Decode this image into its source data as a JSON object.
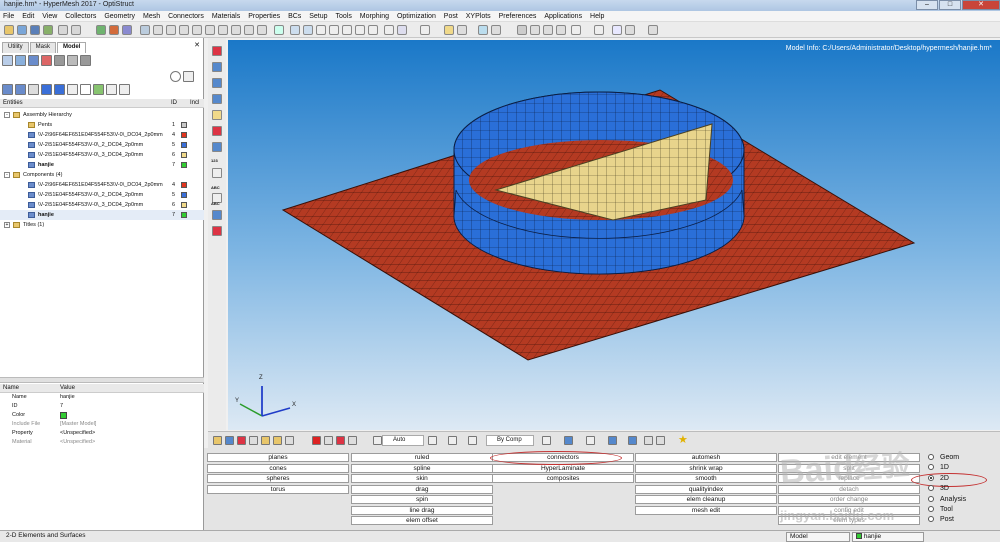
{
  "window": {
    "title": "hanjie.hm* - HyperMesh 2017 - OptiStruct"
  },
  "menu": [
    "File",
    "Edit",
    "View",
    "Collectors",
    "Geometry",
    "Mesh",
    "Connectors",
    "Materials",
    "Properties",
    "BCs",
    "Setup",
    "Tools",
    "Morphing",
    "Optimization",
    "Post",
    "XYPlots",
    "Preferences",
    "Applications",
    "Help"
  ],
  "left_panel": {
    "tabs": [
      "Utility",
      "Mask",
      "Model"
    ],
    "active_tab": "Model",
    "entities_header": {
      "entities": "Entities",
      "id": "ID",
      "incl": "Incl"
    },
    "tree": [
      {
        "label": "Assembly Hierarchy",
        "indent": 0,
        "kind": "folder",
        "expander": "-"
      },
      {
        "label": "Pents",
        "indent": 2,
        "kind": "folder",
        "id": "1",
        "color": "#c8c8c8"
      },
      {
        "label": "\\V-2\\96F64EF651E04F554F53\\V-0\\_DC04_2p0mm",
        "indent": 2,
        "kind": "comp",
        "id": "4",
        "color": "#e0351e"
      },
      {
        "label": "\\V-2\\51E04F554F53\\V-0\\_2_DC04_2p0mm",
        "indent": 2,
        "kind": "comp",
        "id": "5",
        "color": "#3a6fd8"
      },
      {
        "label": "\\V-2\\51E04F554F53\\V-0\\_3_DC04_2p0mm",
        "indent": 2,
        "kind": "comp",
        "id": "6",
        "color": "#f0d98a"
      },
      {
        "label": "hanjie",
        "indent": 2,
        "kind": "comp",
        "id": "7",
        "color": "#33cc33",
        "bold": true
      },
      {
        "label": "Components (4)",
        "indent": 0,
        "kind": "folder",
        "expander": "-"
      },
      {
        "label": "\\V-2\\96F64EF651E04F554F53\\V-0\\_DC04_2p0mm",
        "indent": 2,
        "kind": "comp",
        "id": "4",
        "color": "#e0351e"
      },
      {
        "label": "\\V-2\\51E04F554F53\\V-0\\_2_DC04_2p0mm",
        "indent": 2,
        "kind": "comp",
        "id": "5",
        "color": "#3a6fd8"
      },
      {
        "label": "\\V-2\\51E04F554F53\\V-0\\_3_DC04_2p0mm",
        "indent": 2,
        "kind": "comp",
        "id": "6",
        "color": "#f0d98a"
      },
      {
        "label": "hanjie",
        "indent": 2,
        "kind": "comp",
        "id": "7",
        "color": "#33cc33",
        "bold": true,
        "selected": true
      },
      {
        "label": "Titles (1)",
        "indent": 0,
        "kind": "folder",
        "expander": "+"
      }
    ],
    "properties": {
      "header": {
        "name": "Name",
        "value": "Value"
      },
      "rows": [
        {
          "key": "Name",
          "value": "hanjie"
        },
        {
          "key": "ID",
          "value": "7"
        },
        {
          "key": "Color",
          "value": "",
          "swatch": "#33cc33"
        },
        {
          "key": "Include File",
          "value": "[Master Model]",
          "grey": true
        },
        {
          "key": "Property",
          "value": "<Unspecified>"
        },
        {
          "key": "Material",
          "value": "<Unspecified>",
          "grey": true
        }
      ]
    }
  },
  "viewport": {
    "model_info": "Model Info: C:/Users/Administrator/Desktop/hypermesh/hanjie.hm*",
    "axis": {
      "x": "X",
      "y": "Y",
      "z": "Z"
    }
  },
  "bottom_toolbar": {
    "auto_label": "Auto",
    "by_comp_label": "By Comp"
  },
  "panels": {
    "col1": [
      "planes",
      "cones",
      "spheres",
      "torus"
    ],
    "col2": [
      "ruled",
      "spline",
      "skin",
      "drag",
      "spin",
      "line drag",
      "elem offset"
    ],
    "col3": [
      "connectors",
      "HyperLaminate",
      "composites"
    ],
    "col4": [
      "automesh",
      "shrink wrap",
      "smooth",
      "qualityindex",
      "elem cleanup",
      "mesh edit"
    ],
    "col5": [
      "edit element",
      "split",
      "replace",
      "detach",
      "order change",
      "config edit",
      "elem types"
    ],
    "radios": [
      "Geom",
      "1D",
      "2D",
      "3D",
      "Analysis",
      "Tool",
      "Post"
    ],
    "radio_selected": "2D"
  },
  "statusbar": {
    "message": "2-D Elements and Surfaces",
    "model": "Model",
    "component": "hanjie"
  },
  "colors": {
    "plate": "#b43a22",
    "ring": "#2a6fd8",
    "shelf": "#e8d48c",
    "selected": "#33cc33"
  }
}
